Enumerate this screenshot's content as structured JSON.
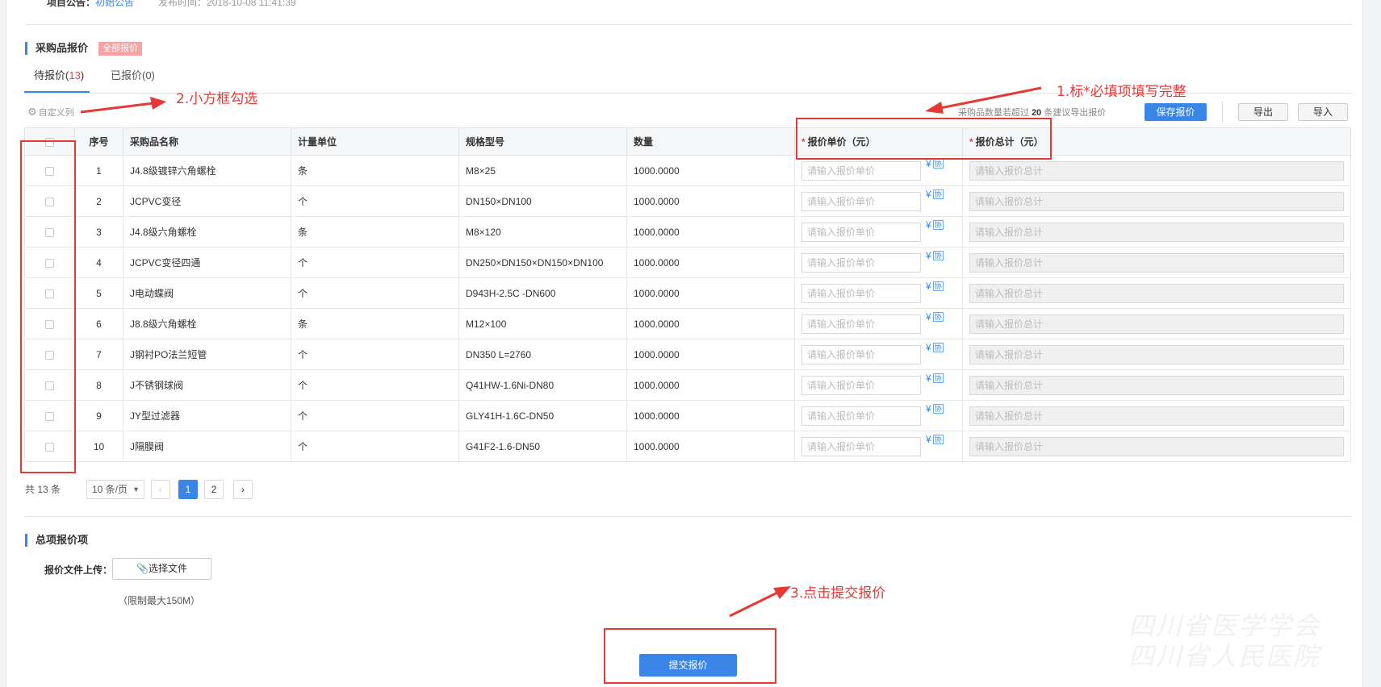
{
  "header": {
    "notice_label": "项目公告：",
    "notice_link": "初始公告",
    "publish_time": "发布时间：2018-10-08 11:41:39"
  },
  "section_items": {
    "title": "采购品报价",
    "badge": "全部报价",
    "tabs": [
      {
        "label": "待报价(",
        "count": "13",
        "suffix": ")",
        "active": true
      },
      {
        "label": "已报价(0)",
        "active": false
      }
    ]
  },
  "toolbar": {
    "custom_columns": "自定义列",
    "hint_prefix": "采购品数量若超过",
    "hint_num": "20",
    "hint_suffix": "条建议导出报价",
    "save_label": "保存报价",
    "export_label": "导出",
    "import_label": "导入"
  },
  "table": {
    "headers": {
      "no": "序号",
      "name": "采购品名称",
      "unit": "计量单位",
      "spec": "规格型号",
      "qty": "数量",
      "price": "报价单价（元）",
      "sum": "报价总计（元）",
      "required_mark": "*"
    },
    "price_placeholder": "请输入报价单价",
    "total_placeholder": "请输入报价总计",
    "currency_icon": "¥",
    "assist_icon": "协",
    "rows": [
      {
        "no": "1",
        "name": "J4.8级镀锌六角螺栓",
        "unit": "条",
        "spec": "M8×25",
        "qty": "1000.0000"
      },
      {
        "no": "2",
        "name": "JCPVC变径",
        "unit": "个",
        "spec": "DN150×DN100",
        "qty": "1000.0000"
      },
      {
        "no": "3",
        "name": "J4.8级六角螺栓",
        "unit": "条",
        "spec": "M8×120",
        "qty": "1000.0000"
      },
      {
        "no": "4",
        "name": "JCPVC变径四通",
        "unit": "个",
        "spec": "DN250×DN150×DN150×DN100",
        "qty": "1000.0000"
      },
      {
        "no": "5",
        "name": "J电动蝶阀",
        "unit": "个",
        "spec": "D943H-2.5C -DN600",
        "qty": "1000.0000"
      },
      {
        "no": "6",
        "name": "J8.8级六角螺栓",
        "unit": "条",
        "spec": "M12×100",
        "qty": "1000.0000"
      },
      {
        "no": "7",
        "name": "J钢衬PO法兰短管",
        "unit": "个",
        "spec": "DN350 L=2760",
        "qty": "1000.0000"
      },
      {
        "no": "8",
        "name": "J不锈钢球阀",
        "unit": "个",
        "spec": "Q41HW-1.6Ni-DN80",
        "qty": "1000.0000"
      },
      {
        "no": "9",
        "name": "JY型过滤器",
        "unit": "个",
        "spec": "GLY41H-1.6C-DN50",
        "qty": "1000.0000"
      },
      {
        "no": "10",
        "name": "J隔膜阀",
        "unit": "个",
        "spec": "G41F2-1.6-DN50",
        "qty": "1000.0000"
      }
    ]
  },
  "pagination": {
    "total": "共 13 条",
    "page_size": "10 条/页",
    "prev": "‹",
    "next": "›",
    "pages": [
      "1",
      "2"
    ],
    "current": "1"
  },
  "section_total": {
    "title": "总项报价项",
    "upload_label": "报价文件上传：",
    "upload_button": "选择文件",
    "limit": "（限制最大150M）"
  },
  "submit_label": "提交报价",
  "annotations": {
    "step1": "1.标*必填项填写完整",
    "step2": "2.小方框勾选",
    "step3": "3.点击提交报价"
  },
  "watermark": [
    "四川省医学学会",
    "四川省人民医院"
  ],
  "colors": {
    "accent": "#3a86e8",
    "annotation": "#e53935",
    "badge": "#f5a3a3"
  }
}
